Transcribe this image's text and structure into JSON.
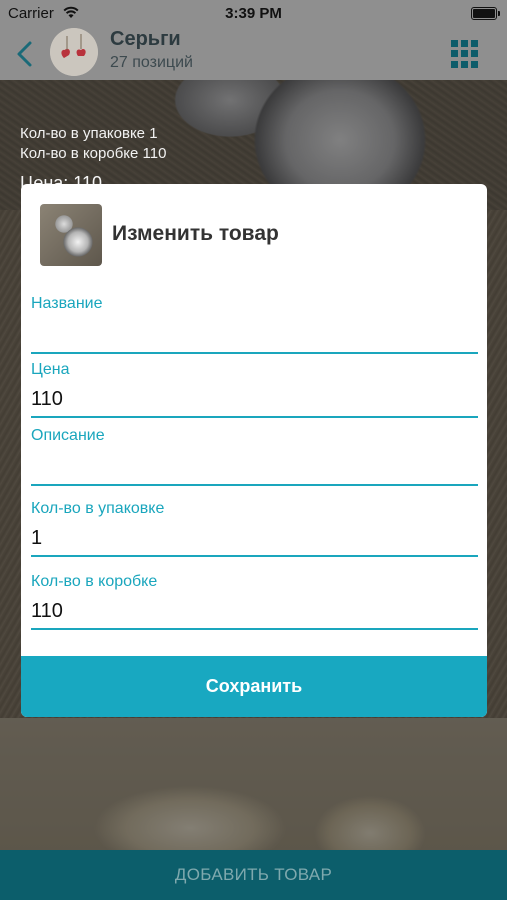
{
  "status_bar": {
    "carrier": "Carrier",
    "time": "3:39 PM"
  },
  "nav": {
    "title": "Серьги",
    "subtitle": "27 позиций"
  },
  "card": {
    "pack_line": "Кол-во в упаковке 1",
    "box_line": "Кол-во в коробке 110",
    "price_line": "Цена: 110"
  },
  "modal": {
    "title": "Изменить товар",
    "fields": {
      "name": {
        "label": "Название",
        "value": ""
      },
      "price": {
        "label": "Цена",
        "value": "110"
      },
      "description": {
        "label": "Описание",
        "value": ""
      },
      "pack_qty": {
        "label": "Кол-во в упаковке",
        "value": "1"
      },
      "box_qty": {
        "label": "Кол-во в коробке",
        "value": "110"
      }
    },
    "save_label": "Сохранить"
  },
  "bottom": {
    "add_label": "ДОБАВИТЬ ТОВАР"
  },
  "colors": {
    "accent": "#18a8c1",
    "primary_dark": "#0c5e6b"
  },
  "icons": {
    "back": "chevron-left-icon",
    "grid": "grid-icon",
    "wifi": "wifi-icon",
    "battery": "battery-icon"
  }
}
